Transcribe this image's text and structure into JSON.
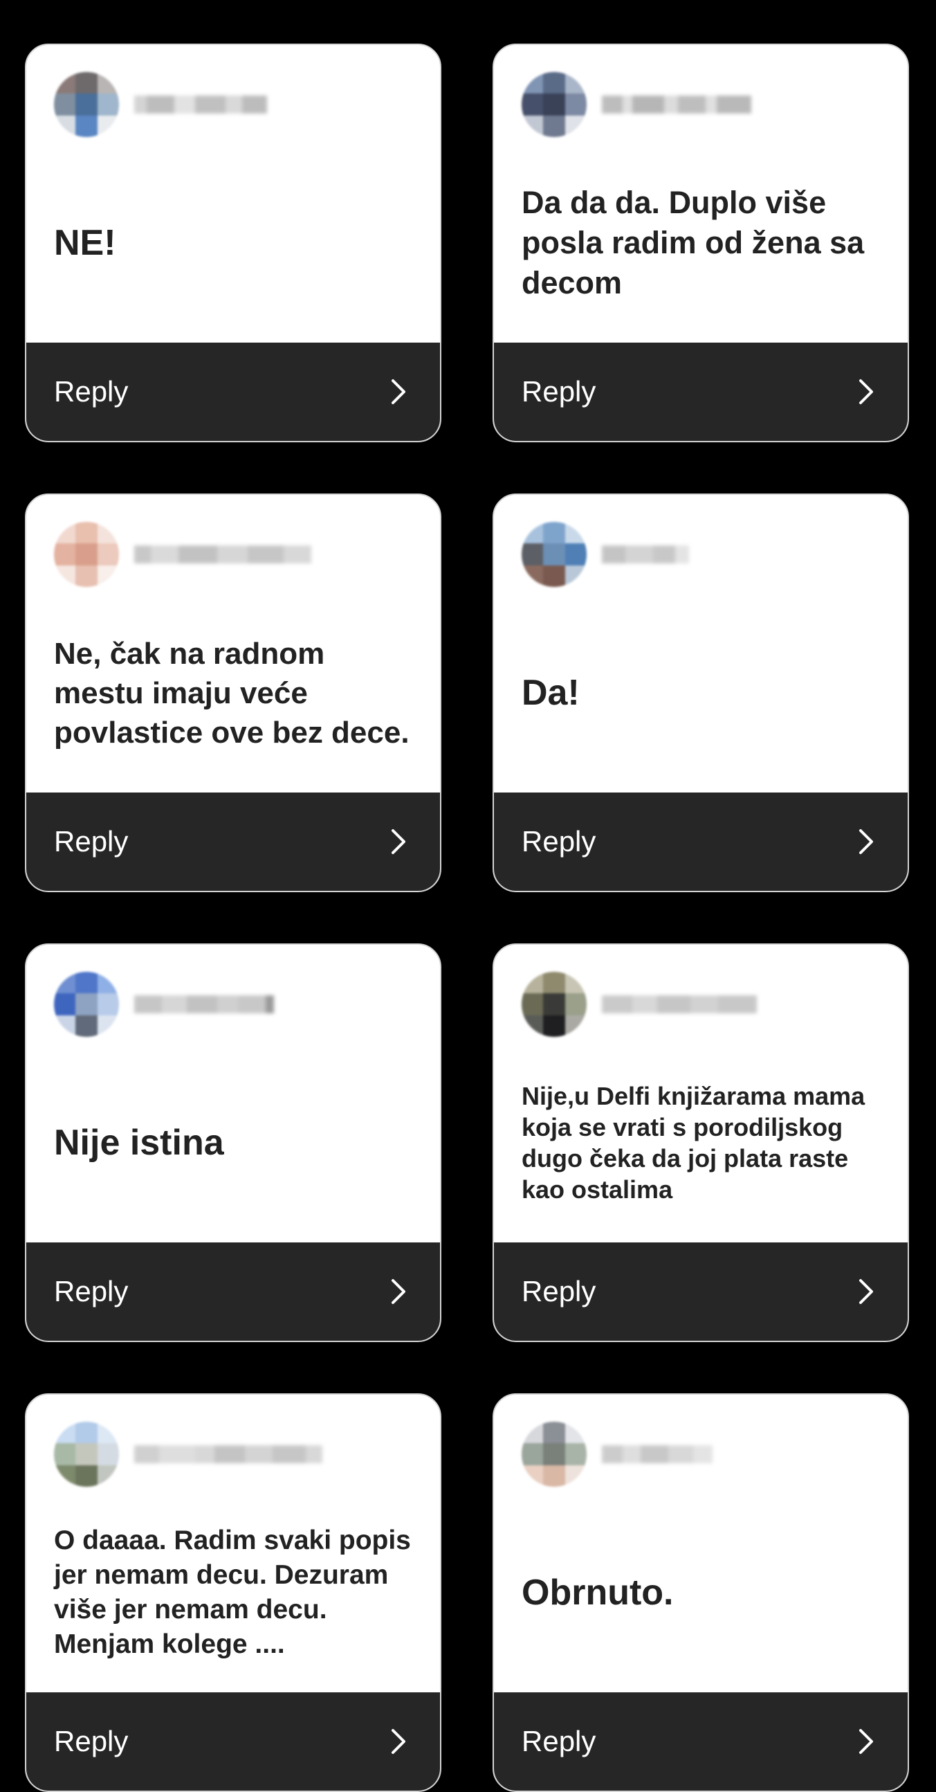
{
  "colors": {
    "background": "#000000",
    "card": "#ffffff",
    "reply_bar": "#262626",
    "text": "#222222",
    "reply_text": "#ffffff"
  },
  "cards": [
    {
      "comment": "NE!",
      "reply_label": "Reply",
      "username": "(blurred)",
      "avatar_icon": "avatar-icon"
    },
    {
      "comment": "Da da da. Duplo više posla radim od žena sa decom",
      "reply_label": "Reply",
      "username": "(blurred)",
      "avatar_icon": "avatar-icon"
    },
    {
      "comment": "Ne, čak na radnom mestu imaju veće povlastice ove bez dece.",
      "reply_label": "Reply",
      "username": "(blurred)",
      "avatar_icon": "avatar-icon"
    },
    {
      "comment": "Da!",
      "reply_label": "Reply",
      "username": "(blurred)",
      "avatar_icon": "avatar-icon"
    },
    {
      "comment": "Nije istina",
      "reply_label": "Reply",
      "username": "(blurred)",
      "avatar_icon": "avatar-icon"
    },
    {
      "comment": "Nije,u Delfi knjižarama mama koja se vrati s porodiljskog dugo čeka da joj plata raste kao ostalima",
      "reply_label": "Reply",
      "username": "(blurred)",
      "avatar_icon": "avatar-icon"
    },
    {
      "comment": "O daaaa. Radim svaki popis jer nemam decu. Dezuram više jer nemam decu. Menjam kolege ....",
      "reply_label": "Reply",
      "username": "(blurred)",
      "avatar_icon": "avatar-icon"
    },
    {
      "comment": "Obrnuto.",
      "reply_label": "Reply",
      "username": "(blurred)",
      "avatar_icon": "avatar-icon"
    }
  ]
}
